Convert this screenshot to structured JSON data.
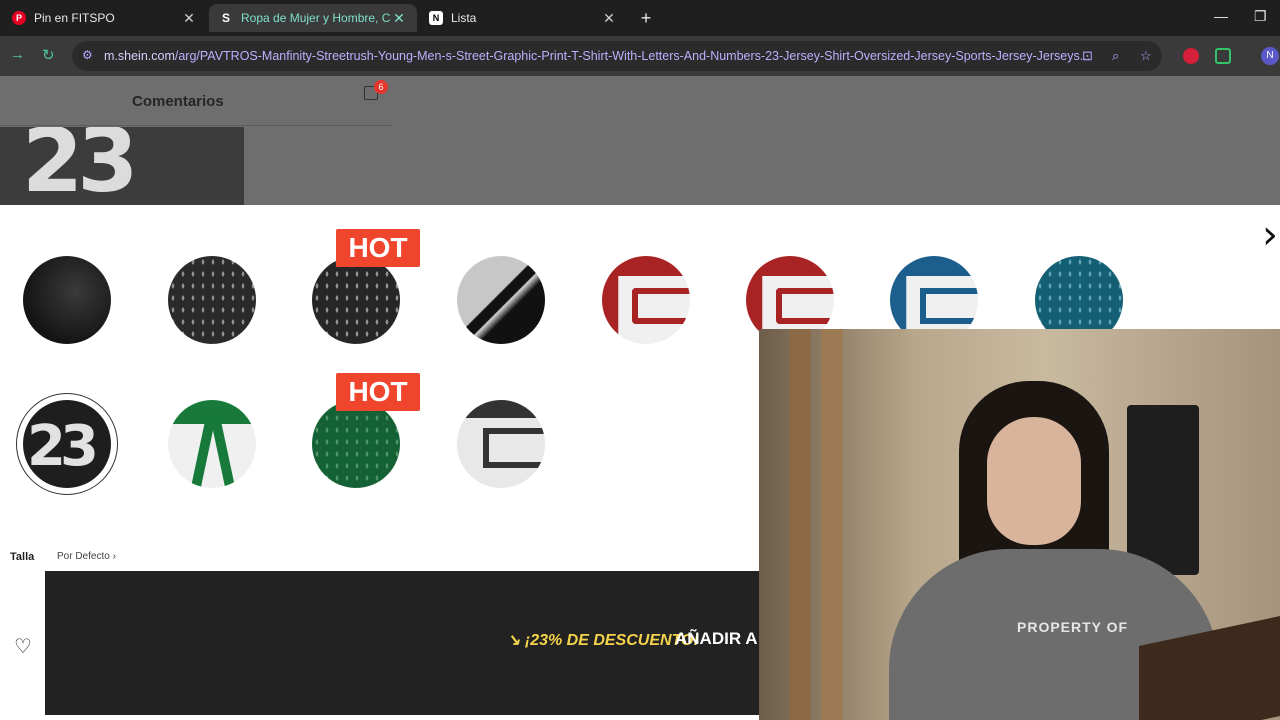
{
  "browser": {
    "tabs": [
      {
        "title": "Pin en FITSPO",
        "icon": "pinterest-icon"
      },
      {
        "title": "Ropa de Mujer y Hombre, Compra Online | SHEIN",
        "icon": "shein-icon",
        "active": true
      },
      {
        "title": "Lista",
        "icon": "notion-icon"
      }
    ],
    "url_host": "m.shein.com",
    "url_path": "/arg/PAVTROS-Manfinity-Streetrush-Young-Men-s-Street-Graphic-Print-T-Shirt-With-Letters-And-Numbers-23-Jersey-Shirt-Oversized-Jersey-Sports-Jersey-Jerseys...",
    "profile_initial": "N"
  },
  "page": {
    "comments_title": "Comentarios",
    "cart_count": "6",
    "swatches": [
      {
        "pattern": "dark-solid",
        "hot": false
      },
      {
        "pattern": "black-mesh",
        "hot": false
      },
      {
        "pattern": "black-mesh",
        "hot": true
      },
      {
        "pattern": "grey-black-panel",
        "hot": false
      },
      {
        "pattern": "red-white-panel",
        "hot": false
      },
      {
        "pattern": "red-white-panel",
        "hot": false
      },
      {
        "pattern": "blue-white-panel",
        "hot": false
      },
      {
        "pattern": "teal-mesh",
        "hot": false
      },
      {
        "pattern": "number-23",
        "hot": false,
        "selected": true
      },
      {
        "pattern": "green-white-panel",
        "hot": false
      },
      {
        "pattern": "green-mesh",
        "hot": true
      },
      {
        "pattern": "dark-grey-panel",
        "hot": false
      }
    ],
    "hot_label": "HOT",
    "size_label": "Talla",
    "size_default_link": "Por Defecto",
    "discount_text": "¡23% DE DESCUENTO!",
    "add_to_cart_text": "AÑADIR A",
    "thumb_number": "23"
  },
  "webcam": {
    "shirt_text": "PROPERTY OF"
  },
  "colors": {
    "hot_badge": "#f0452d",
    "discount": "#f5d34a",
    "cta_bg": "#222222"
  }
}
